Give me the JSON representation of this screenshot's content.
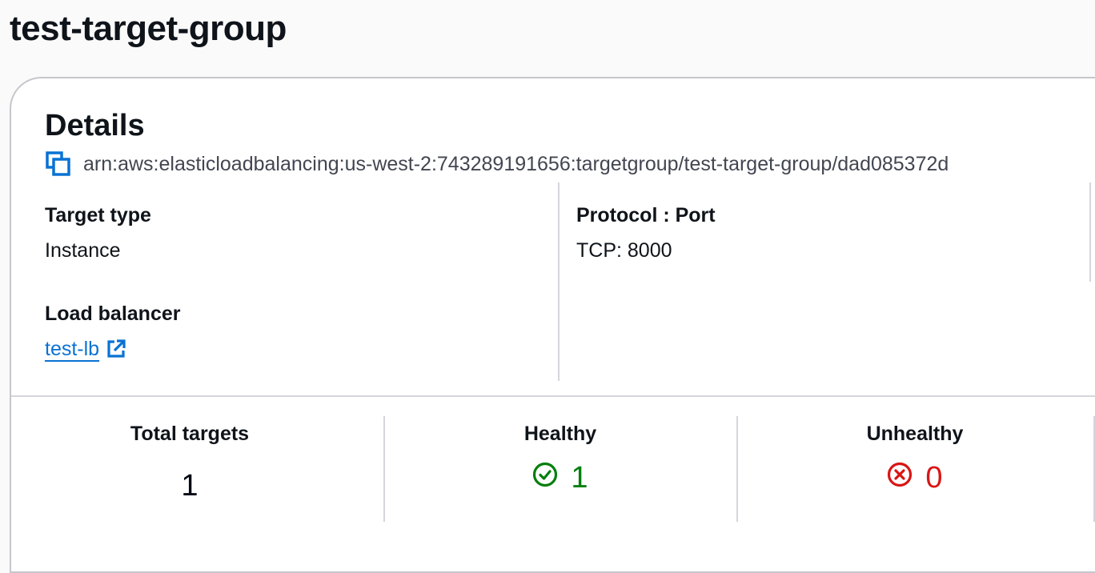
{
  "page": {
    "title": "test-target-group"
  },
  "details": {
    "header": "Details",
    "arn": "arn:aws:elasticloadbalancing:us-west-2:743289191656:targetgroup/test-target-group/dad085372d",
    "target_type_label": "Target type",
    "target_type_value": "Instance",
    "protocol_port_label": "Protocol : Port",
    "protocol_port_value": "TCP: 8000",
    "load_balancer_label": "Load balancer",
    "load_balancer_value": "test-lb"
  },
  "stats": {
    "total_label": "Total targets",
    "total_value": "1",
    "healthy_label": "Healthy",
    "healthy_value": "1",
    "unhealthy_label": "Unhealthy",
    "unhealthy_value": "0"
  },
  "icons": {
    "copy": "copy-icon",
    "external_link": "external-link-icon",
    "healthy": "check-circle-icon",
    "unhealthy": "x-circle-icon"
  },
  "colors": {
    "link": "#0972d3",
    "healthy": "#037f0c",
    "unhealthy": "#d91515"
  }
}
